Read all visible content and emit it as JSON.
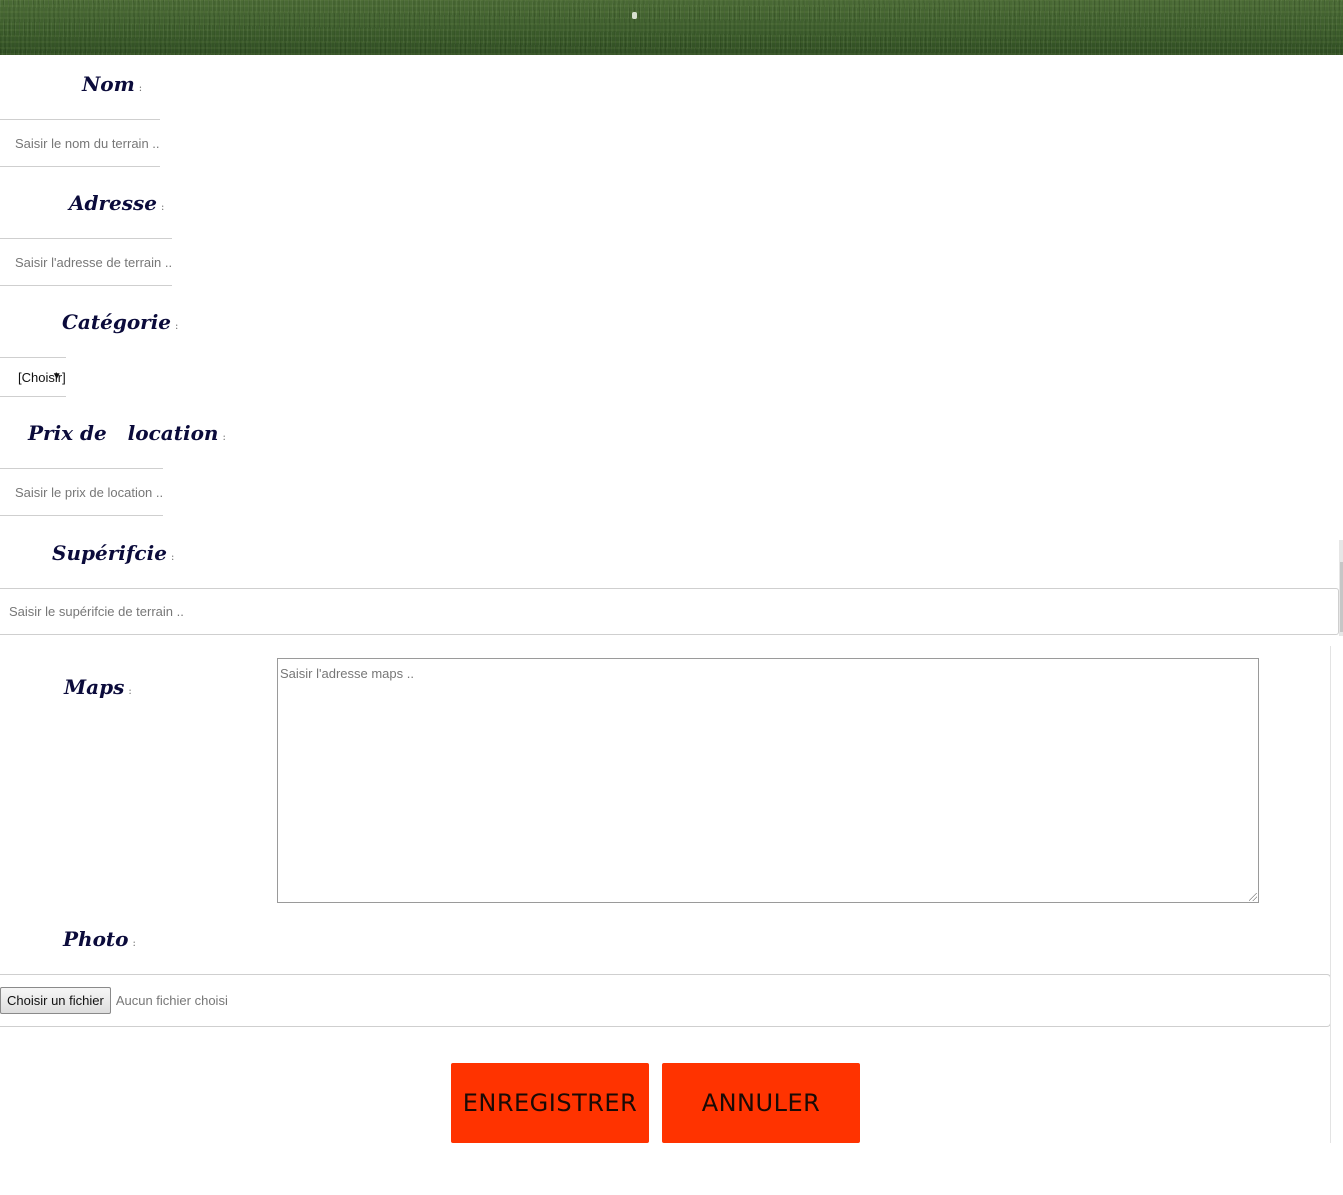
{
  "header": {
    "background": "grass"
  },
  "form": {
    "nom": {
      "label": "Nom",
      "colon": ":",
      "placeholder": "Saisir le nom du terrain .."
    },
    "adresse": {
      "label": "Adresse",
      "colon": ":",
      "placeholder": "Saisir l'adresse de terrain  .."
    },
    "categorie": {
      "label": "Catégorie",
      "colon": ":",
      "selected": "[Choisir]",
      "caret": "▼"
    },
    "prix": {
      "label": "Prix de   location",
      "colon": ":",
      "placeholder": "Saisir le prix de location  .."
    },
    "superficie": {
      "label": "Supérifcie",
      "colon": ":",
      "placeholder": "Saisir le supérifcie de terrain  .."
    },
    "maps": {
      "label": "Maps",
      "colon": ":",
      "placeholder": "Saisir l'adresse maps .."
    },
    "photo": {
      "label": "Photo",
      "colon": ":",
      "button_label": "Choisir un fichier",
      "status": "Aucun fichier choisi"
    }
  },
  "actions": {
    "save_label": "ENREGISTRER",
    "cancel_label": "ANNULER",
    "button_color": "#ff3300"
  },
  "colors": {
    "label": "#0b0b3b",
    "border": "#cfcfcf"
  }
}
